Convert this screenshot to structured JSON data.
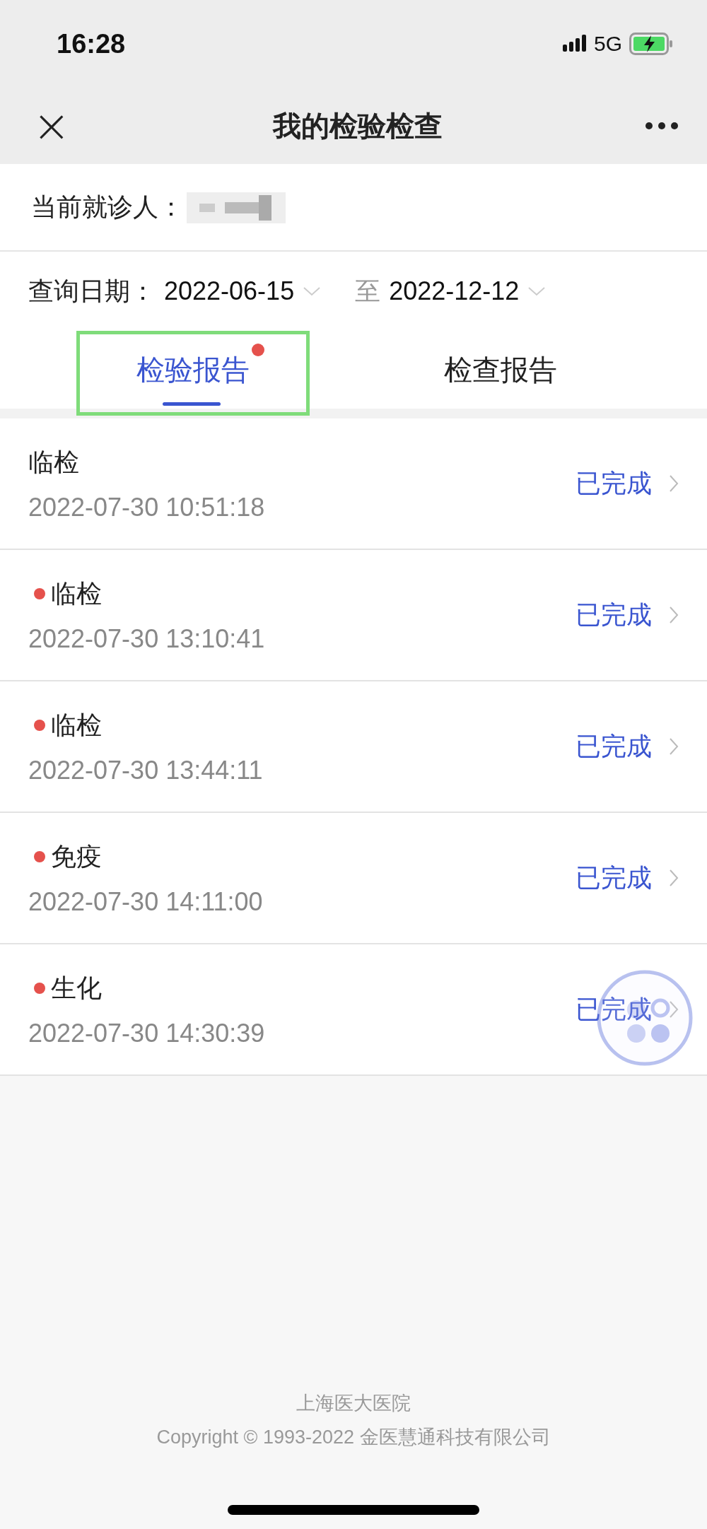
{
  "status_bar": {
    "time": "16:28",
    "network": "5G"
  },
  "nav": {
    "title": "我的检验检查",
    "close": "×"
  },
  "patient": {
    "label": "当前就诊人："
  },
  "date_query": {
    "label": "查询日期：",
    "from": "2022-06-15",
    "separator": "至",
    "to": "2022-12-12"
  },
  "tabs": [
    {
      "label": "检验报告",
      "selected": true,
      "badge": true,
      "highlighted": true
    },
    {
      "label": "检查报告",
      "selected": false,
      "badge": false,
      "highlighted": false
    }
  ],
  "reports": [
    {
      "name": "临检",
      "time": "2022-07-30 10:51:18",
      "status": "已完成",
      "unread": false
    },
    {
      "name": "临检",
      "time": "2022-07-30 13:10:41",
      "status": "已完成",
      "unread": true
    },
    {
      "name": "临检",
      "time": "2022-07-30 13:44:11",
      "status": "已完成",
      "unread": true
    },
    {
      "name": "免疫",
      "time": "2022-07-30 14:11:00",
      "status": "已完成",
      "unread": true
    },
    {
      "name": "生化",
      "time": "2022-07-30 14:30:39",
      "status": "已完成",
      "unread": true
    }
  ],
  "footer": {
    "hospital": "上海医大医院",
    "copyright": "Copyright © 1993-2022 金医慧通科技有限公司"
  }
}
